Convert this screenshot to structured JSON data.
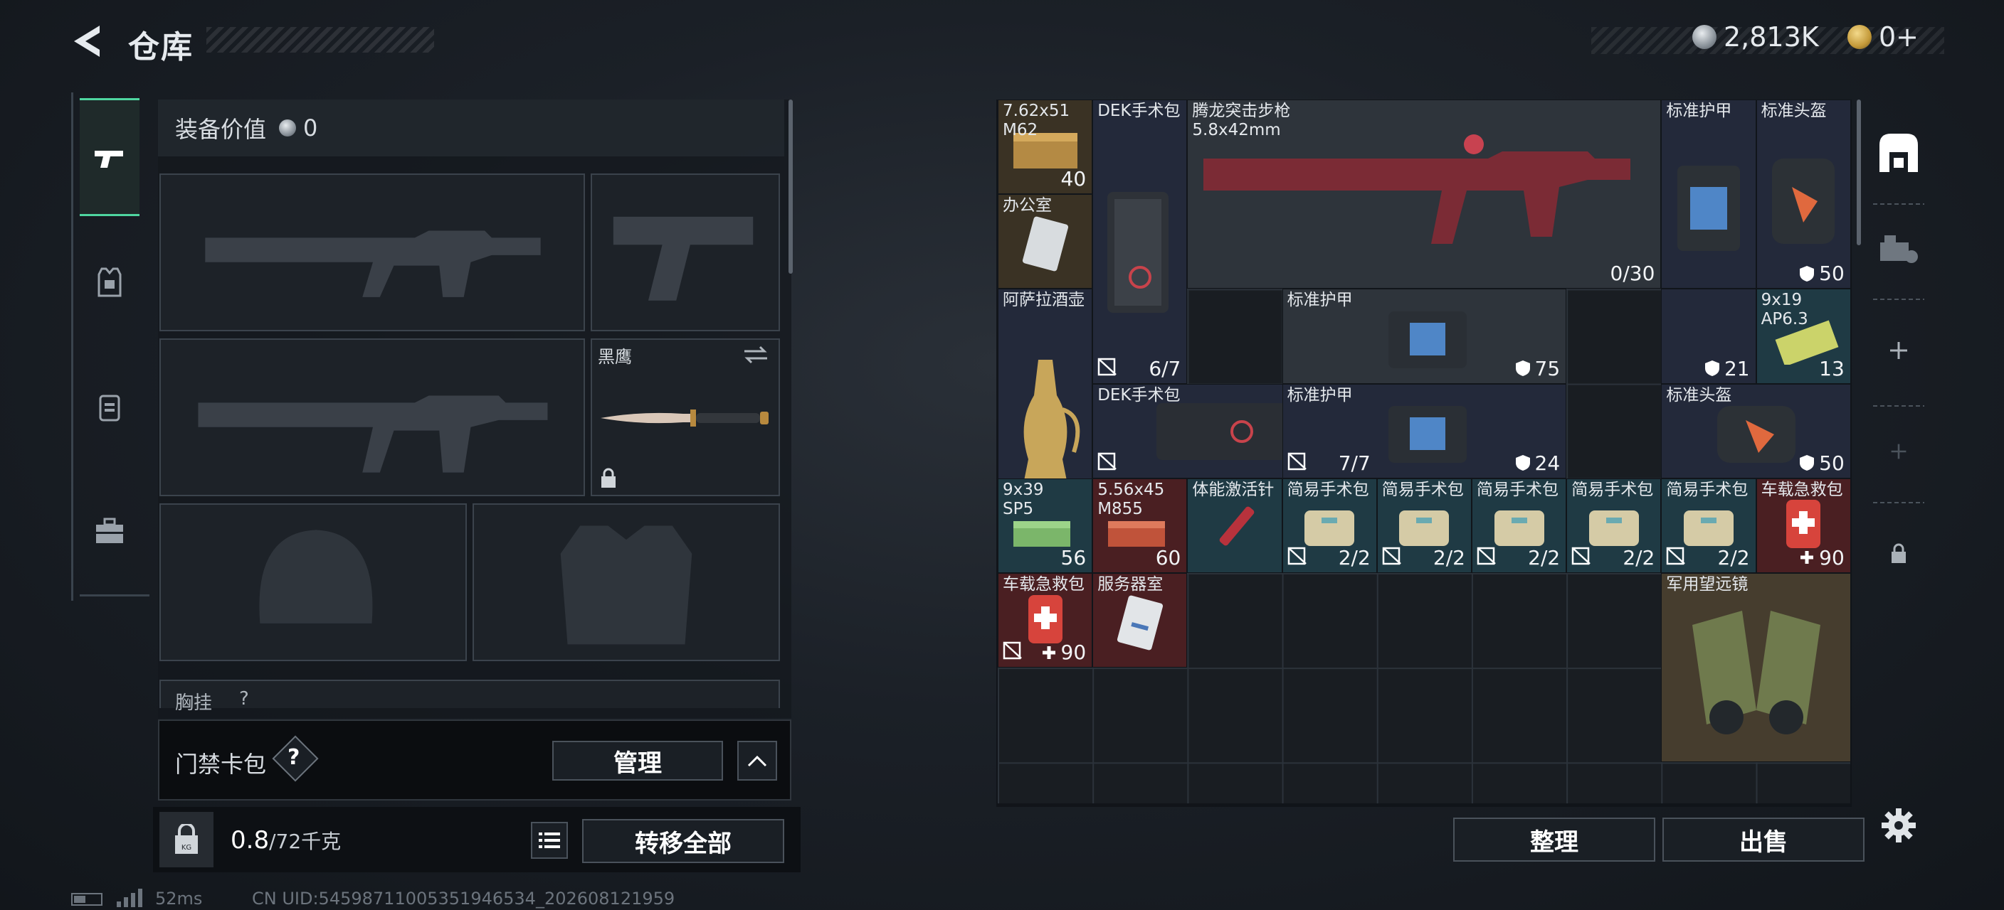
{
  "header": {
    "title": "仓库",
    "silver": "2,813K",
    "gold": "0+"
  },
  "loadout": {
    "equip_value_label": "装备价值",
    "equip_value": "0",
    "knife_name": "黑鹰",
    "chest_rig_label": "胸挂",
    "chest_rig_count": "?",
    "card_bag_label": "门禁卡包",
    "card_bag_help": "?",
    "manage_label": "管理",
    "weight_value": "0.8",
    "weight_max": "/72千克",
    "transfer_all_label": "转移全部"
  },
  "stash": {
    "items": [
      {
        "name": "7.62x51\nM62",
        "count": "40"
      },
      {
        "name": "办公室",
        "count": ""
      },
      {
        "name": "DEK手术包",
        "count": "6/7"
      },
      {
        "name": "腾龙突击步枪\n5.8x42mm",
        "count": "0/30"
      },
      {
        "name": "标准护甲",
        "count": ""
      },
      {
        "name": "标准头盔",
        "count": "50"
      },
      {
        "name": "阿萨拉酒壶",
        "count": ""
      },
      {
        "name": "标准护甲",
        "count": "75"
      },
      {
        "name": "",
        "count": "21"
      },
      {
        "name": "9x19\nAP6.3",
        "count": "13"
      },
      {
        "name": "DEK手术包",
        "count": "7/7"
      },
      {
        "name": "标准护甲",
        "count": "24"
      },
      {
        "name": "标准头盔",
        "count": "50"
      },
      {
        "name": "9x39\nSP5",
        "count": "56"
      },
      {
        "name": "5.56x45\nM855",
        "count": "60"
      },
      {
        "name": "体能激活针",
        "count": ""
      },
      {
        "name": "简易手术包",
        "count": "2/2"
      },
      {
        "name": "简易手术包",
        "count": "2/2"
      },
      {
        "name": "简易手术包",
        "count": "2/2"
      },
      {
        "name": "简易手术包",
        "count": "2/2"
      },
      {
        "name": "简易手术包",
        "count": "2/2"
      },
      {
        "name": "车载急救包",
        "count": "90"
      },
      {
        "name": "车载急救包",
        "count": "90"
      },
      {
        "name": "服务器室",
        "count": ""
      },
      {
        "name": "军用望远镜",
        "count": ""
      }
    ],
    "sort_label": "整理",
    "sell_label": "出售"
  },
  "footer": {
    "ping": "52ms",
    "uid": "CN UID:5459871100535194653​4_202608121959"
  },
  "colors": {
    "accent_green": "#4fd6a0",
    "cell_blue": "#23293a",
    "cell_gold": "#3a3224",
    "cell_teal": "#1f3a44",
    "cell_red": "#4a1f22"
  }
}
